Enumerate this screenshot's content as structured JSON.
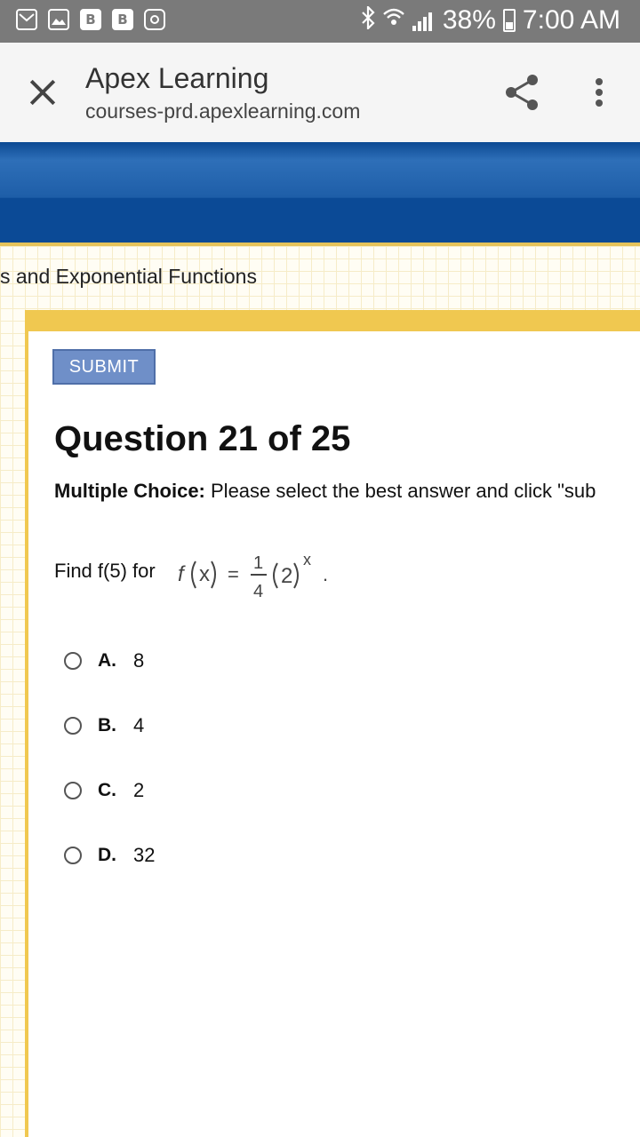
{
  "status_bar": {
    "notification_icons": [
      "gmail-icon",
      "gallery-icon",
      "b-app-icon",
      "b-app-icon",
      "instagram-icon"
    ],
    "battery": "38%",
    "time": "7:00 AM"
  },
  "browser_toolbar": {
    "title": "Apex Learning",
    "url": "courses-prd.apexlearning.com"
  },
  "page": {
    "unit_title": "s and Exponential Functions",
    "submit_label": "SUBMIT",
    "question_title": "Question 21 of 25",
    "instructions_bold": "Multiple Choice:",
    "instructions_text": " Please select the best answer and click \"sub",
    "prompt_text": "Find f(5) for",
    "options": [
      {
        "letter": "A.",
        "value": "8"
      },
      {
        "letter": "B.",
        "value": "4"
      },
      {
        "letter": "C.",
        "value": "2"
      },
      {
        "letter": "D.",
        "value": "32"
      }
    ]
  },
  "colors": {
    "status_bar": "#7a7a7a",
    "banner_blue": "#0b4a96",
    "accent_yellow": "#f0c850",
    "submit_blue": "#6f8fc8"
  }
}
